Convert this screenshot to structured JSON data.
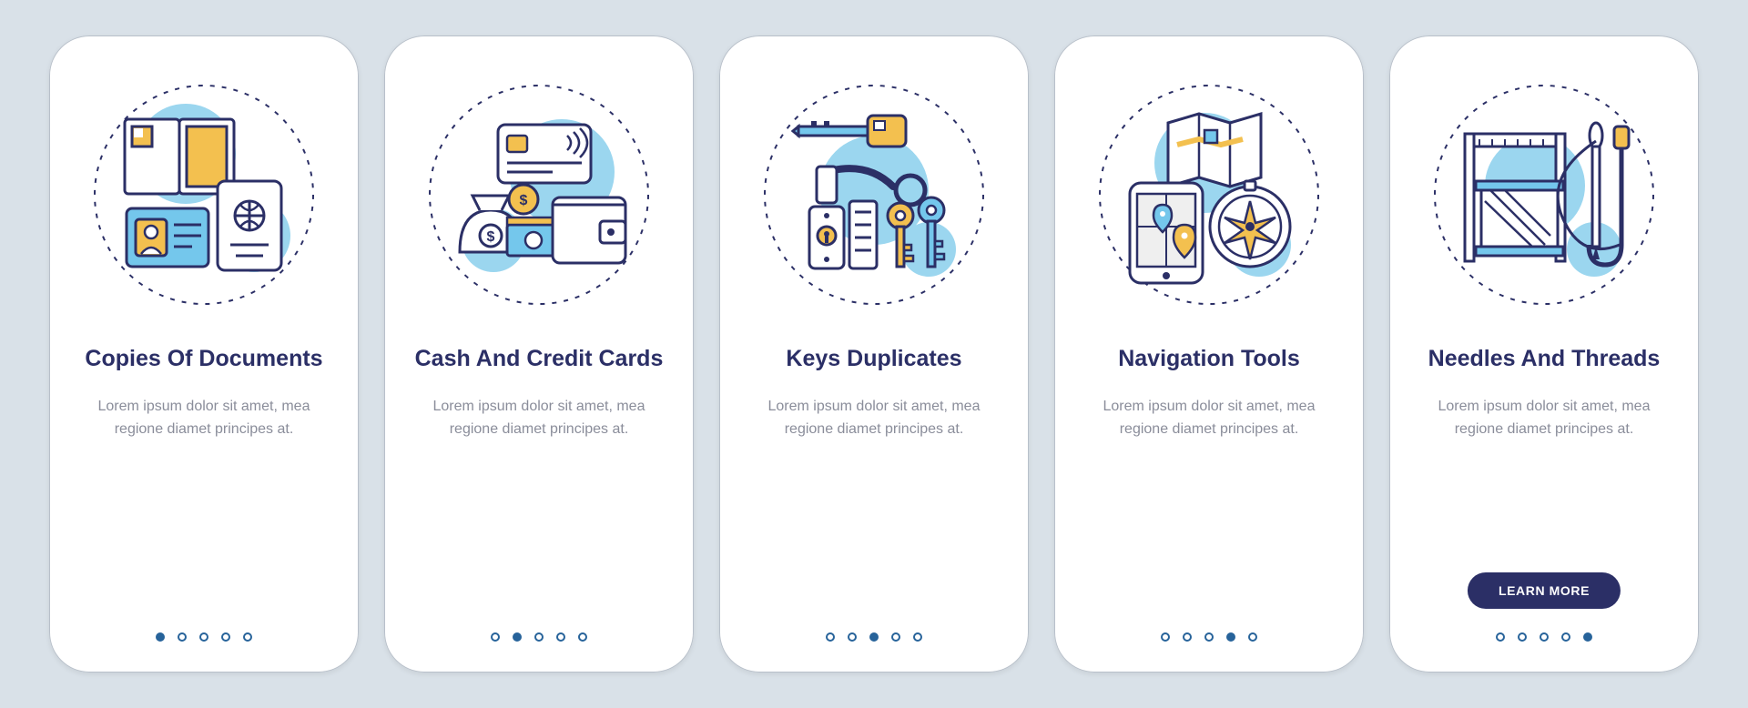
{
  "colors": {
    "background": "#d9e1e8",
    "card_bg": "#ffffff",
    "title": "#2b2f66",
    "body_text": "#8a8d9a",
    "accent_blue": "#6bc2e8",
    "dashed_stroke": "#2b2f66",
    "dot_outline": "#27639a",
    "button_bg": "#2b2f66",
    "icon_yellow": "#f3c04f",
    "icon_blue": "#74c7ec",
    "icon_navy": "#2b2f66"
  },
  "cards": [
    {
      "title": "Copies Of Documents",
      "desc": "Lorem ipsum dolor sit amet, mea regione diamet principes at.",
      "active_dot": 0,
      "has_button": false,
      "icon": "documents-icon"
    },
    {
      "title": "Cash And Credit Cards",
      "desc": "Lorem ipsum dolor sit amet, mea regione diamet principes at.",
      "active_dot": 1,
      "has_button": false,
      "icon": "cash-icon"
    },
    {
      "title": "Keys Duplicates",
      "desc": "Lorem ipsum dolor sit amet, mea regione diamet principes at.",
      "active_dot": 2,
      "has_button": false,
      "icon": "keys-icon"
    },
    {
      "title": "Navigation Tools",
      "desc": "Lorem ipsum dolor sit amet, mea regione diamet principes at.",
      "active_dot": 3,
      "has_button": false,
      "icon": "navigation-icon"
    },
    {
      "title": "Needles And Threads",
      "desc": "Lorem ipsum dolor sit amet, mea regione diamet principes at.",
      "active_dot": 4,
      "has_button": true,
      "icon": "sewing-icon"
    }
  ],
  "button_label": "LEARN MORE",
  "pager_count": 5
}
